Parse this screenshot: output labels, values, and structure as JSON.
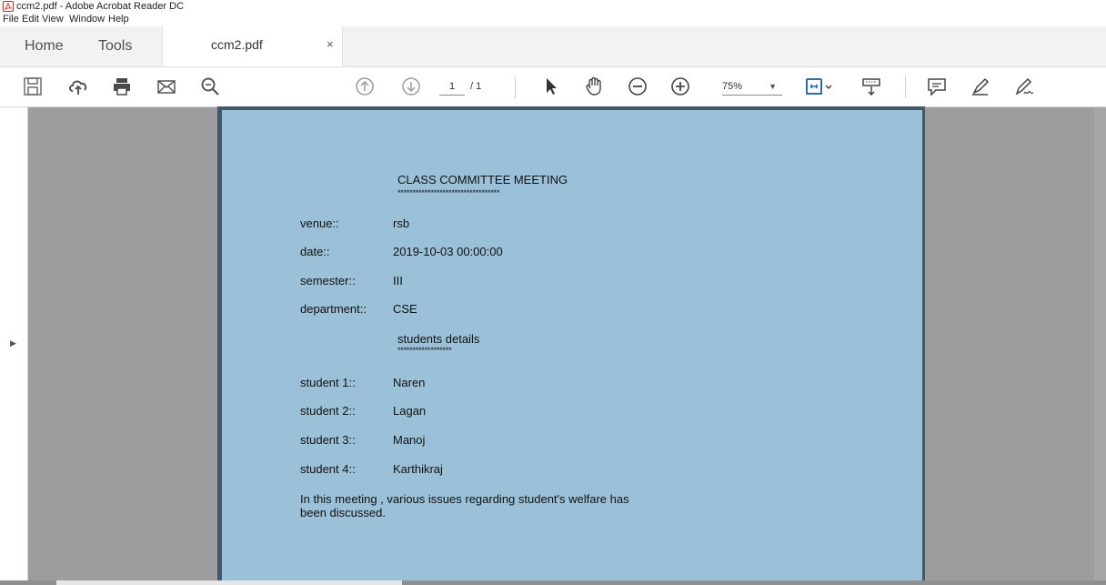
{
  "window": {
    "title": "ccm2.pdf - Adobe Acrobat Reader DC",
    "icon": "pdf-icon"
  },
  "menu": [
    "File",
    "Edit",
    "View",
    "Window",
    "Help"
  ],
  "tabs": {
    "home": "Home",
    "tools": "Tools",
    "document": "ccm2.pdf",
    "close": "×"
  },
  "toolbar": {
    "icons": [
      "save-icon",
      "upload-icon",
      "print-icon",
      "email-icon",
      "zoom-search-icon",
      "previous-page-icon",
      "next-page-icon",
      "select-cursor-icon",
      "hand-icon",
      "zoom-out-icon",
      "zoom-in-icon",
      "fit-page-icon",
      "scroll-mode-icon",
      "comment-icon",
      "highlight-icon",
      "sign-icon"
    ],
    "page_current": "1",
    "page_total": "/ 1",
    "zoom": "75%"
  },
  "document": {
    "title": "CLASS COMMITTEE MEETING",
    "title_stars": "**********************************",
    "fields": [
      {
        "label": "venue::",
        "value": "rsb"
      },
      {
        "label": "date::",
        "value": "2019-10-03 00:00:00"
      },
      {
        "label": "semester::",
        "value": "III"
      },
      {
        "label": "department::",
        "value": "CSE"
      }
    ],
    "section": "students details",
    "section_stars": "******************",
    "students": [
      {
        "label": "student 1::",
        "value": "Naren"
      },
      {
        "label": "student 2::",
        "value": "Lagan"
      },
      {
        "label": "student 3::",
        "value": "Manoj"
      },
      {
        "label": "student 4::",
        "value": "Karthikraj"
      }
    ],
    "summary_line1": "In this meeting , various issues regarding student's welfare has",
    "summary_line2": "been discussed."
  }
}
